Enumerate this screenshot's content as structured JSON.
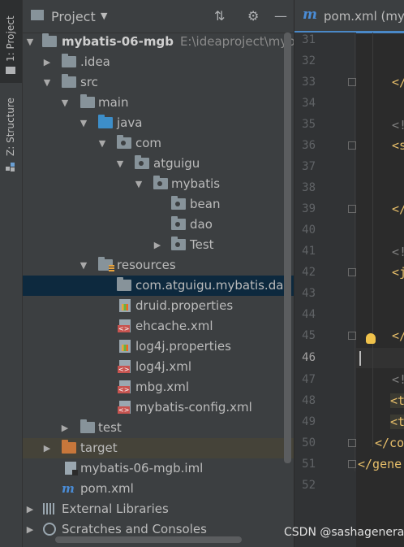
{
  "side_tabs": [
    {
      "label": "1: Project"
    },
    {
      "label": "Z: Structure"
    }
  ],
  "panel": {
    "title": "Project",
    "buttons": {
      "collapse": "⇅",
      "settings": "⚙",
      "hide": "—"
    }
  },
  "tree": [
    {
      "label": "mybatis-06-mgb",
      "extra": "E:\\ideaproject\\mybati",
      "expanded": true,
      "icon": "module-folder-icon"
    },
    {
      "label": ".idea",
      "expanded": false,
      "icon": "folder-icon"
    },
    {
      "label": "src",
      "expanded": true,
      "icon": "folder-icon"
    },
    {
      "label": "main",
      "expanded": true,
      "icon": "folder-icon"
    },
    {
      "label": "java",
      "expanded": true,
      "icon": "source-folder-icon"
    },
    {
      "label": "com",
      "expanded": true,
      "icon": "package-icon"
    },
    {
      "label": "atguigu",
      "expanded": true,
      "icon": "package-icon"
    },
    {
      "label": "mybatis",
      "expanded": true,
      "icon": "package-icon"
    },
    {
      "label": "bean",
      "icon": "package-icon"
    },
    {
      "label": "dao",
      "icon": "package-icon"
    },
    {
      "label": "Test",
      "expanded": false,
      "icon": "package-icon"
    },
    {
      "label": "resources",
      "expanded": true,
      "icon": "resources-folder-icon"
    },
    {
      "label": "com.atguigu.mybatis.dao",
      "icon": "folder-icon",
      "selected": true
    },
    {
      "label": "druid.properties",
      "icon": "properties-file-icon"
    },
    {
      "label": "ehcache.xml",
      "icon": "xml-file-icon"
    },
    {
      "label": "log4j.properties",
      "icon": "properties-file-icon"
    },
    {
      "label": "log4j.xml",
      "icon": "xml-file-icon"
    },
    {
      "label": "mbg.xml",
      "icon": "xml-file-icon"
    },
    {
      "label": "mybatis-config.xml",
      "icon": "xml-file-icon"
    },
    {
      "label": "test",
      "expanded": false,
      "icon": "folder-icon"
    },
    {
      "label": "target",
      "expanded": false,
      "icon": "excluded-folder-icon"
    },
    {
      "label": "mybatis-06-mgb.iml",
      "icon": "iml-file-icon"
    },
    {
      "label": "pom.xml",
      "icon": "maven-icon"
    },
    {
      "label": "External Libraries",
      "expanded": false,
      "icon": "libraries-icon"
    },
    {
      "label": "Scratches and Consoles",
      "expanded": false,
      "icon": "scratches-icon"
    }
  ],
  "editor": {
    "tab_label": "pom.xml (myb",
    "tab_icon": "m",
    "line_numbers": [
      "31",
      "32",
      "33",
      "34",
      "35",
      "36",
      "37",
      "38",
      "39",
      "40",
      "41",
      "42",
      "43",
      "44",
      "45",
      "46",
      "47",
      "48",
      "49",
      "50",
      "51",
      "52"
    ],
    "current_line": "46",
    "code_fragments": {
      "33": "</",
      "35": "<!",
      "36": "<s",
      "39": "</",
      "41": "<!",
      "42": "<j",
      "45": "</",
      "47": "<!",
      "48": "<t",
      "49": "<t",
      "50": "</co",
      "51": "</gene"
    }
  },
  "watermark": "CSDN @sashagenerat"
}
